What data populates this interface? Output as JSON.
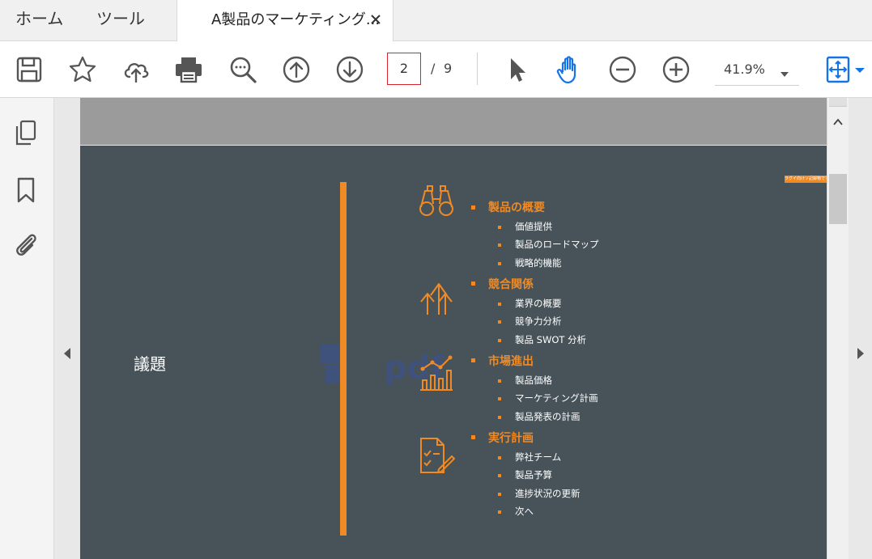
{
  "tabs": {
    "home": "ホーム",
    "tools": "ツール",
    "document": "A製品のマーケティング..."
  },
  "toolbar": {
    "icons": [
      "save-icon",
      "star-icon",
      "cloud-upload-icon",
      "print-icon",
      "zoom-search-icon",
      "page-up-icon",
      "page-down-icon",
      "select-cursor-icon",
      "hand-tool-icon",
      "zoom-out-icon",
      "zoom-in-icon",
      "fit-page-icon"
    ],
    "current_page": "2",
    "page_separator": "/",
    "total_pages": "9",
    "zoom": "41.9%"
  },
  "sidebar": {
    "icons": [
      "page-thumbnails-icon",
      "bookmark-icon",
      "attachment-icon"
    ]
  },
  "slide": {
    "title": "議題",
    "badge": "ラグイ向けソ記録物です",
    "sections": [
      {
        "icon": "binoculars-icon",
        "title": "製品の概要",
        "items": [
          "価値提供",
          "製品のロードマップ",
          "戦略的機能"
        ]
      },
      {
        "icon": "arrows-up-icon",
        "title": "競合関係",
        "items": [
          "業界の概要",
          "競争力分析",
          "製品 SWOT 分析"
        ]
      },
      {
        "icon": "line-chart-icon",
        "title": "市場進出",
        "items": [
          "製品価格",
          "マーケティング計画",
          "製品発表の計画"
        ]
      },
      {
        "icon": "checklist-icon",
        "title": "実行計画",
        "items": [
          "弊社チーム",
          "製品予算",
          "進捗状況の更新",
          "次へ"
        ]
      }
    ]
  },
  "colors": {
    "accent": "#f08a24",
    "slide_bg": "#475359",
    "active_blue": "#1473e6",
    "page_box_border": "#d9232e"
  }
}
